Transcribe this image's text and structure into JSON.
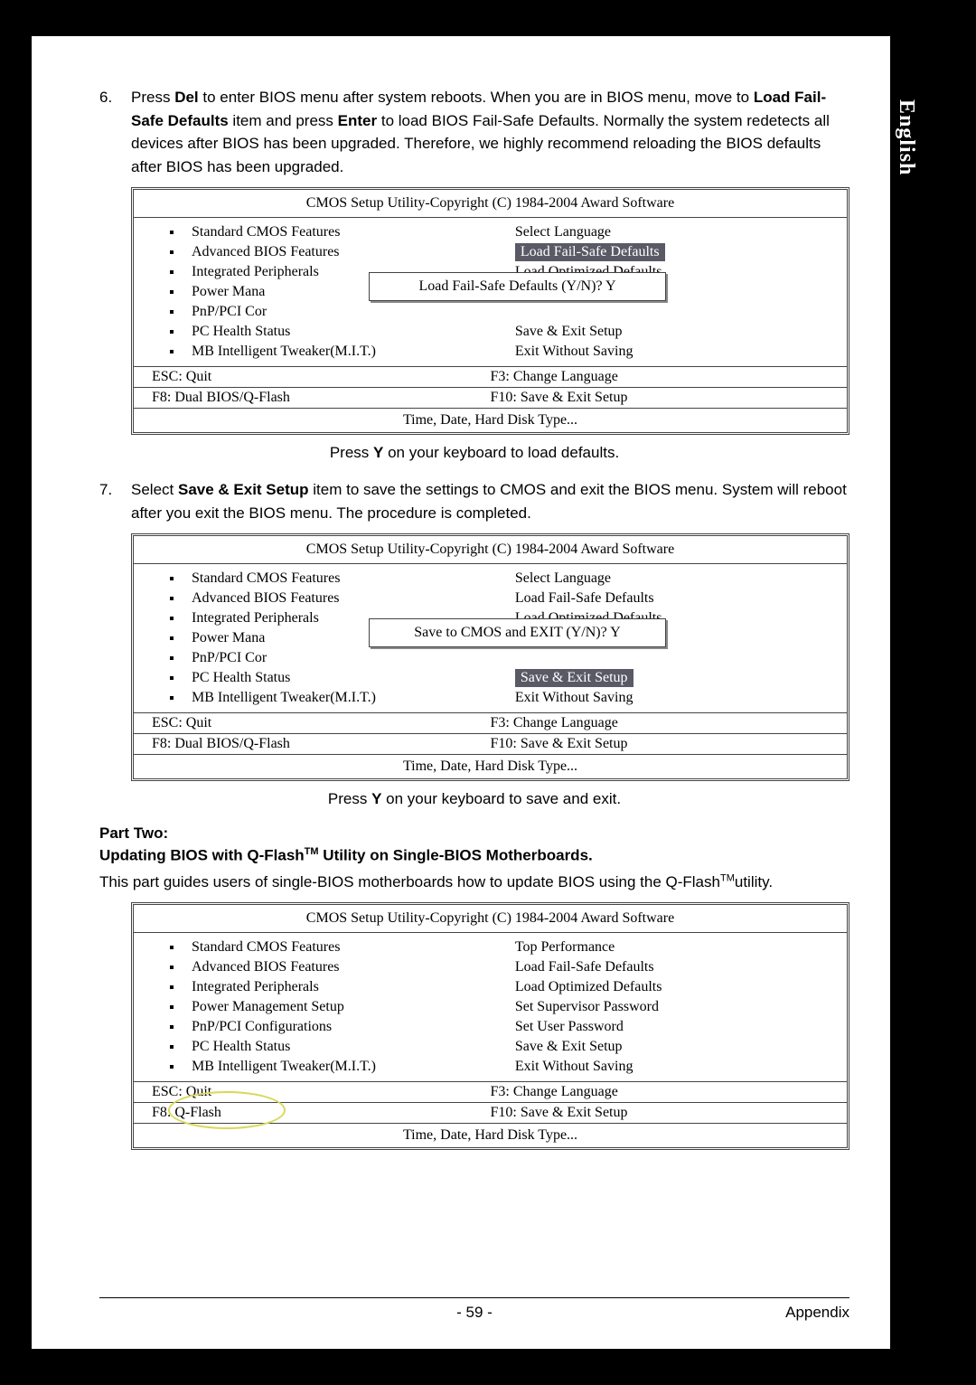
{
  "sidetab": "English",
  "step6": {
    "num": "6.",
    "text_parts": [
      "Press ",
      "Del",
      " to enter BIOS menu after system reboots. When you are in BIOS menu, move to ",
      "Load Fail-Safe Defaults",
      " item and press ",
      "Enter",
      " to load BIOS Fail-Safe Defaults. Normally the system redetects all devices after BIOS has been upgraded. Therefore, we highly recommend reloading the BIOS defaults after BIOS has been upgraded."
    ]
  },
  "bios_common": {
    "title": "CMOS Setup Utility-Copyright (C) 1984-2004 Award Software",
    "left_items": [
      "Standard CMOS Features",
      "Advanced BIOS Features",
      "Integrated Peripherals",
      "Power Management Setup",
      "PnP/PCI Configurations",
      "PC Health Status",
      "MB Intelligent Tweaker(M.I.T.)"
    ],
    "left_items_trunc": [
      "Power Mana",
      "PnP/PCI Cor"
    ],
    "right_items_a": [
      "Select Language",
      "Load Fail-Safe Defaults",
      "Load Optimized Defaults",
      "Save & Exit Setup",
      "Exit Without Saving"
    ],
    "right_items_c": [
      "Top Performance",
      "Load Fail-Safe Defaults",
      "Load Optimized Defaults",
      "Set Supervisor Password",
      "Set User Password",
      "Save & Exit Setup",
      "Exit Without Saving"
    ],
    "keys": {
      "esc": "ESC: Quit",
      "f3": "F3: Change Language",
      "f8a": "F8: Dual BIOS/Q-Flash",
      "f8c": "F8: Q-Flash",
      "f10": "F10: Save & Exit Setup"
    },
    "status": "Time, Date, Hard Disk Type..."
  },
  "dialog1": "Load Fail-Safe Defaults (Y/N)? Y",
  "caption1_parts": [
    "Press ",
    "Y",
    " on your keyboard to load defaults."
  ],
  "step7": {
    "num": "7.",
    "text_parts": [
      "Select ",
      "Save & Exit Setup",
      " item to save the settings to CMOS and exit the BIOS menu. System will reboot after you exit the BIOS menu. The procedure is completed."
    ]
  },
  "dialog2": "Save to CMOS and EXIT (Y/N)? Y",
  "caption2_parts": [
    "Press ",
    "Y",
    " on your keyboard to save and exit."
  ],
  "part_two": {
    "title": "Part Two:",
    "subtitle_parts": [
      "Updating BIOS with Q-Flash",
      "TM",
      " Utility on Single-BIOS Motherboards."
    ],
    "body_parts": [
      "This part guides users of single-BIOS motherboards how to update BIOS using the Q-Flash",
      "TM",
      "utility."
    ]
  },
  "footer": {
    "page": "- 59 -",
    "section": "Appendix"
  }
}
